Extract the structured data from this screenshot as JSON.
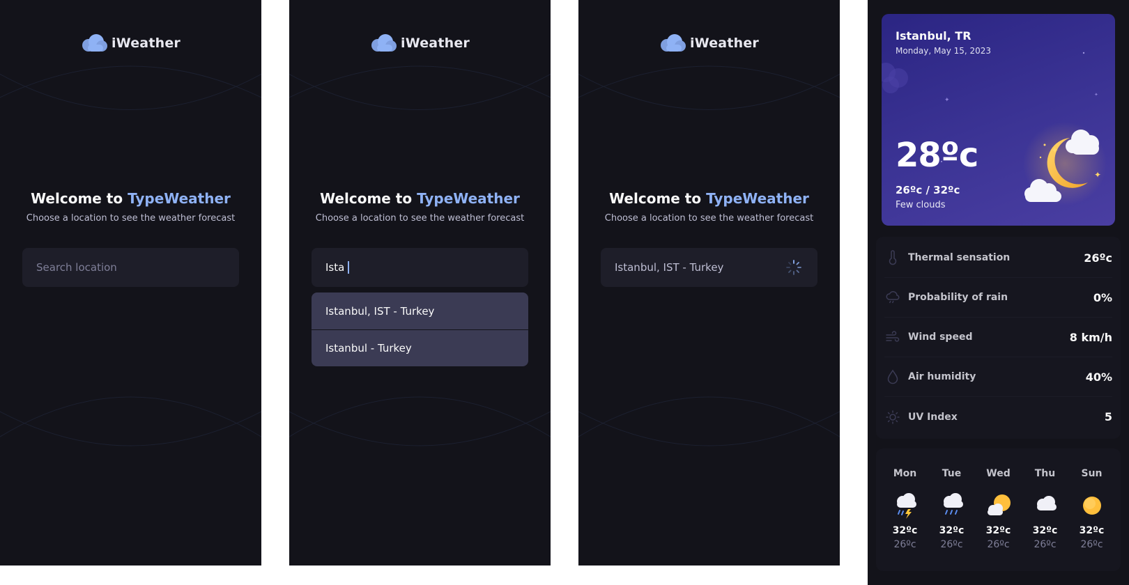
{
  "app": {
    "logo_text": "iWeather"
  },
  "welcome": {
    "prefix": "Welcome to",
    "brand": "TypeWeather",
    "subtitle": "Choose a location to see the weather forecast"
  },
  "search": {
    "placeholder": "Search location",
    "typed_value": "Ista",
    "suggestions": [
      "Istanbul, IST - Turkey",
      "Istanbul - Turkey"
    ],
    "selected_value": "Istanbul, IST - Turkey"
  },
  "detail": {
    "city": "Istanbul, TR",
    "date": "Monday, May 15, 2023",
    "temperature": "28ºc",
    "range": "26ºc / 32ºc",
    "condition": "Few clouds",
    "metrics": [
      {
        "label": "Thermal sensation",
        "value": "26ºc",
        "icon": "thermometer-icon"
      },
      {
        "label": "Probability of rain",
        "value": "0%",
        "icon": "cloud-rain-icon"
      },
      {
        "label": "Wind speed",
        "value": "8 km/h",
        "icon": "wind-icon"
      },
      {
        "label": "Air humidity",
        "value": "40%",
        "icon": "drop-icon"
      },
      {
        "label": "UV Index",
        "value": "5",
        "icon": "sun-icon"
      }
    ],
    "forecast": [
      {
        "day": "Mon",
        "max": "32ºc",
        "min": "26ºc",
        "icon": "storm-icon"
      },
      {
        "day": "Tue",
        "max": "32ºc",
        "min": "26ºc",
        "icon": "rain-icon"
      },
      {
        "day": "Wed",
        "max": "32ºc",
        "min": "26ºc",
        "icon": "sun-cloud-icon"
      },
      {
        "day": "Thu",
        "max": "32ºc",
        "min": "26ºc",
        "icon": "cloud-icon"
      },
      {
        "day": "Sun",
        "max": "32ºc",
        "min": "26ºc",
        "icon": "sun-icon"
      }
    ]
  },
  "colors": {
    "background": "#13131a",
    "accent": "#8fb2f5",
    "input": "#1e1e29",
    "dropdown": "#3b3b54",
    "hero": "#3c3495"
  }
}
